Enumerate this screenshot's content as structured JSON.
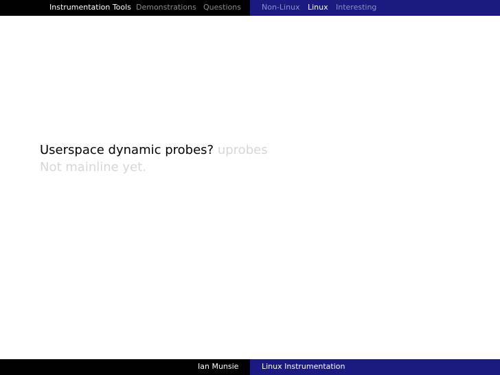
{
  "nav": {
    "sections": [
      {
        "label": "Instrumentation Tools",
        "active": true
      },
      {
        "label": "Demonstrations",
        "active": false
      },
      {
        "label": "Questions",
        "active": false
      }
    ],
    "subsections": [
      {
        "label": "Non-Linux",
        "active": false
      },
      {
        "label": "Linux",
        "active": true
      },
      {
        "label": "Interesting",
        "active": false
      }
    ]
  },
  "slide": {
    "question": "Userspace dynamic probes?",
    "answer": "uprobes",
    "note": "Not mainline yet."
  },
  "footer": {
    "author": "Ian Munsie",
    "title": "Linux Instrumentation"
  },
  "colors": {
    "section_bar": "#000000",
    "subsection_bar": "#1a1a80",
    "active_text": "#ffffff",
    "inactive_text": "#8b8b8b",
    "inactive_subsection_text": "#8e8ecc",
    "faded_text": "#d6d6d6"
  }
}
